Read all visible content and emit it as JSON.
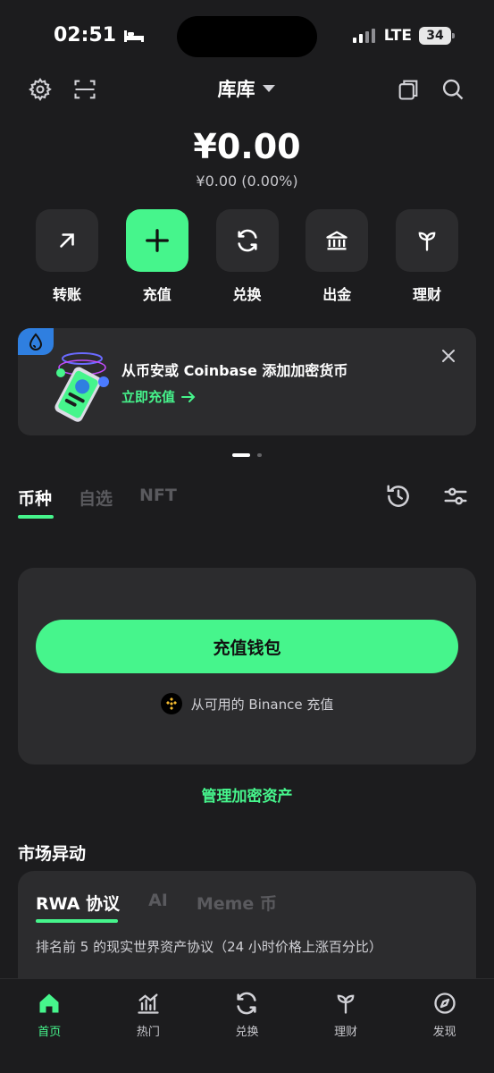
{
  "status_bar": {
    "time": "02:51",
    "network": "LTE",
    "battery": "34"
  },
  "header": {
    "wallet_name": "库库"
  },
  "balance": {
    "amount": "¥0.00",
    "change": "¥0.00 (0.00%)"
  },
  "actions": [
    {
      "label": "转账",
      "icon": "arrow-up-right-icon"
    },
    {
      "label": "充值",
      "icon": "plus-icon"
    },
    {
      "label": "兑换",
      "icon": "swap-icon"
    },
    {
      "label": "出金",
      "icon": "bank-icon"
    },
    {
      "label": "理财",
      "icon": "sprout-icon"
    }
  ],
  "banner": {
    "title": "从币安或 Coinbase 添加加密货币",
    "link": "立即充值",
    "page_count": 2,
    "active_page": 1
  },
  "tabs": [
    {
      "label": "币种",
      "active": true
    },
    {
      "label": "自选",
      "active": false
    },
    {
      "label": "NFT",
      "active": false
    }
  ],
  "empty_state": {
    "deposit_button": "充值钱包",
    "binance_text": "从可用的 Binance 充值"
  },
  "manage_link": "管理加密资产",
  "market": {
    "title": "市场异动",
    "tabs": [
      {
        "label": "RWA 协议",
        "active": true
      },
      {
        "label": "AI",
        "active": false
      },
      {
        "label": "Meme 币",
        "active": false
      }
    ],
    "description": "排名前 5 的现实世界资产协议（24 小时价格上涨百分比）"
  },
  "bottom_nav": [
    {
      "label": "首页",
      "icon": "home-icon",
      "active": true
    },
    {
      "label": "热门",
      "icon": "chart-icon",
      "active": false
    },
    {
      "label": "兑换",
      "icon": "swap-icon",
      "active": false
    },
    {
      "label": "理财",
      "icon": "sprout-icon",
      "active": false
    },
    {
      "label": "发现",
      "icon": "compass-icon",
      "active": false
    }
  ],
  "colors": {
    "accent": "#46f58c",
    "background": "#1c1c1e",
    "card": "#2c2c2e"
  }
}
